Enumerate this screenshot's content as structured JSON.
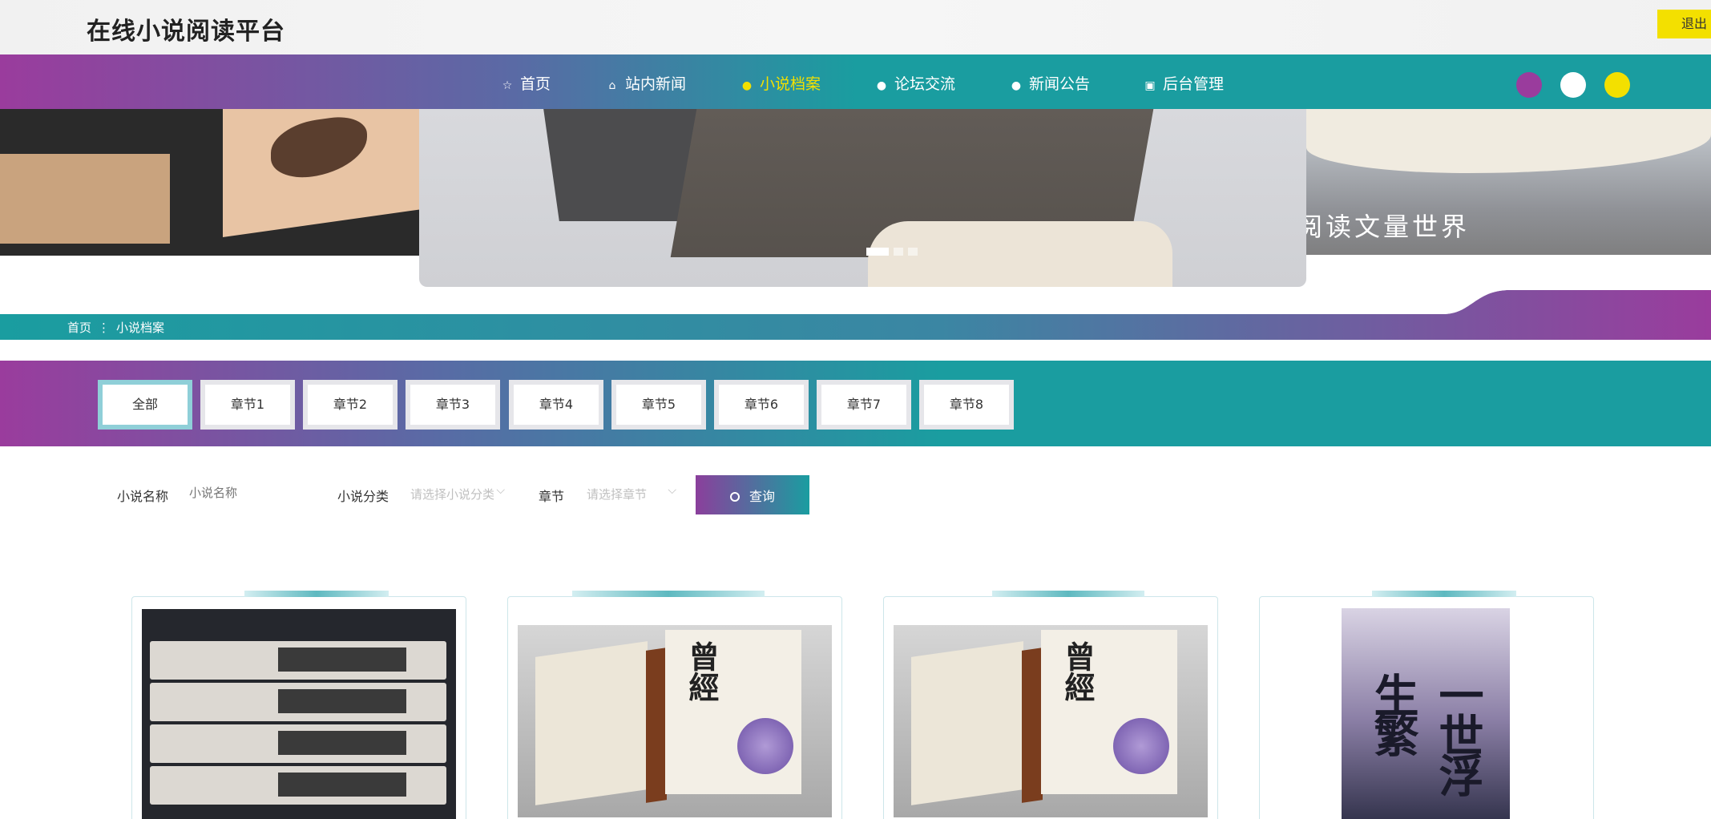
{
  "header": {
    "site_title": "在线小说阅读平台",
    "logout_label": "退出"
  },
  "nav": {
    "items": [
      {
        "label": "首页",
        "icon": "star-icon"
      },
      {
        "label": "站内新闻",
        "icon": "bag-icon"
      },
      {
        "label": "小说档案",
        "icon": "info-icon",
        "active": true
      },
      {
        "label": "论坛交流",
        "icon": "question-icon"
      },
      {
        "label": "新闻公告",
        "icon": "info-icon"
      },
      {
        "label": "后台管理",
        "icon": "calendar-icon"
      }
    ],
    "theme_dots": [
      {
        "color": "#9a3c9d"
      },
      {
        "color": "#ffffff"
      },
      {
        "color": "#f3e000"
      }
    ]
  },
  "banner": {
    "overlay_text": "阅读文量世界",
    "slide_count": 3,
    "active_slide": 1
  },
  "breadcrumb": {
    "home": "首页",
    "separator": "⋮",
    "current": "小说档案"
  },
  "filter": {
    "chips": [
      "全部",
      "章节1",
      "章节2",
      "章节3",
      "章节4",
      "章节5",
      "章节6",
      "章节7",
      "章节8"
    ],
    "active_chip": "全部"
  },
  "search": {
    "name_label": "小说名称",
    "name_placeholder": "小说名称",
    "category_label": "小说分类",
    "category_placeholder": "请选择小说分类",
    "chapter_label": "章节",
    "chapter_placeholder": "请选择章节",
    "button_label": "查询"
  },
  "cards": [
    {
      "image": "stacked-books-photo"
    },
    {
      "image": "book-cover-photo",
      "cover_title": "曾經"
    },
    {
      "image": "book-cover-photo",
      "cover_title": "曾經"
    },
    {
      "image": "novel-poster",
      "cover_title": "一世浮生繁"
    }
  ],
  "colors": {
    "purple": "#9a3c9d",
    "teal": "#1a9da0",
    "yellow": "#f3e000"
  }
}
